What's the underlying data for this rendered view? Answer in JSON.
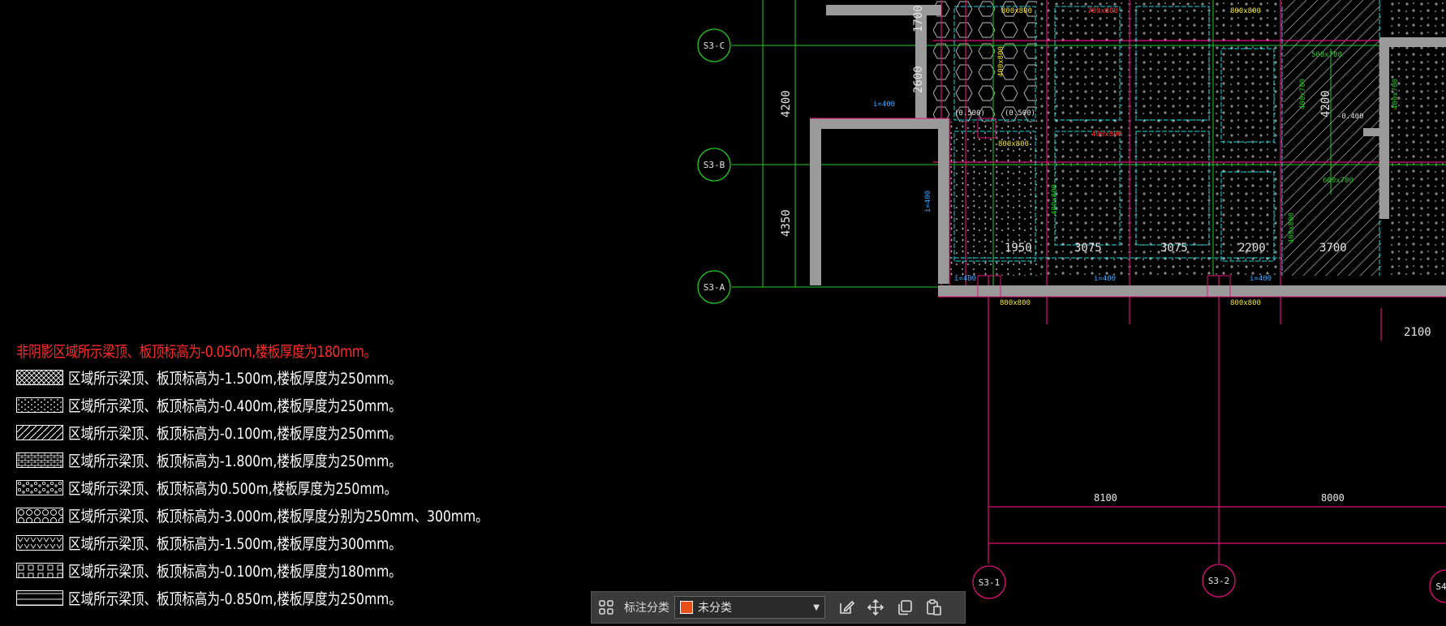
{
  "colors": {
    "axis": "#22cc22",
    "grid_magenta": "#e0117a",
    "wall": "#9a9a9a",
    "beam_cyan": "#20d6e0",
    "legend_title": "#ff2a2a",
    "yellow": "#f2e321",
    "toolbar_chip": "#e8501a"
  },
  "grid_bubbles": {
    "s3c": "S3-C",
    "s3b": "S3-B",
    "s3a": "S3-A",
    "s31": "S3-1",
    "s32": "S3-2",
    "s4": "S4"
  },
  "dims": {
    "d1700": "1700",
    "d2600": "2600",
    "d4200_left": "4200",
    "d4350": "4350",
    "d4200_right": "4200",
    "d1950": "1950",
    "d3075a": "3075",
    "d3075b": "3075",
    "d2200": "2200",
    "d3700": "3700",
    "d2100": "2100",
    "d8100": "8100",
    "d8000": "8000"
  },
  "beams": {
    "b1": "800x800",
    "b2": "700x800",
    "b3": "800x800",
    "b4": "800x800",
    "b5": "800x800",
    "b6": "800x800",
    "b7": "400x800",
    "b8": "400x800",
    "b9": "500x700",
    "b10": "600x700",
    "b11": "400x700",
    "b12": "400x700",
    "b13": "400x800",
    "b14": "400x800"
  },
  "elev": {
    "e1": "(0.500)",
    "e2": "(0.500)",
    "e3": "-0.400",
    "i400a": "i=400",
    "i400b": "i=400",
    "i400c": "i=400",
    "i400d": "i=400",
    "i400e": "i=400"
  },
  "legend": {
    "title": "非阴影区域所示梁顶、板顶标高为-0.050m,楼板厚度为180mm。",
    "rows": [
      {
        "pattern": "crosshatch",
        "text": "区域所示梁顶、板顶标高为-1.500m,楼板厚度为250mm。"
      },
      {
        "pattern": "dots",
        "text": "区域所示梁顶、板顶标高为-0.400m,楼板厚度为250mm。"
      },
      {
        "pattern": "diagonal",
        "text": "区域所示梁顶、板顶标高为-0.100m,楼板厚度为250mm。"
      },
      {
        "pattern": "brick",
        "text": "区域所示梁顶、板顶标高为-1.800m,楼板厚度为250mm。"
      },
      {
        "pattern": "gravel",
        "text": "区域所示梁顶、板顶标高为0.500m,楼板厚度为250mm。"
      },
      {
        "pattern": "circles",
        "text": "区域所示梁顶、板顶标高为-3.000m,楼板厚度分别为250mm、300mm。"
      },
      {
        "pattern": "triangles",
        "text": "区域所示梁顶、板顶标高为-1.500m,楼板厚度为300mm。"
      },
      {
        "pattern": "blocks",
        "text": "区域所示梁顶、板顶标高为-0.100m,楼板厚度为180mm。"
      },
      {
        "pattern": "lines",
        "text": "区域所示梁顶、板顶标高为-0.850m,楼板厚度为250mm。"
      }
    ]
  },
  "toolbar": {
    "label": "标注分类",
    "select_value": "未分类",
    "icons": [
      "grid-icon",
      "edit-icon",
      "move-icon",
      "copy-icon",
      "paste-icon"
    ]
  }
}
